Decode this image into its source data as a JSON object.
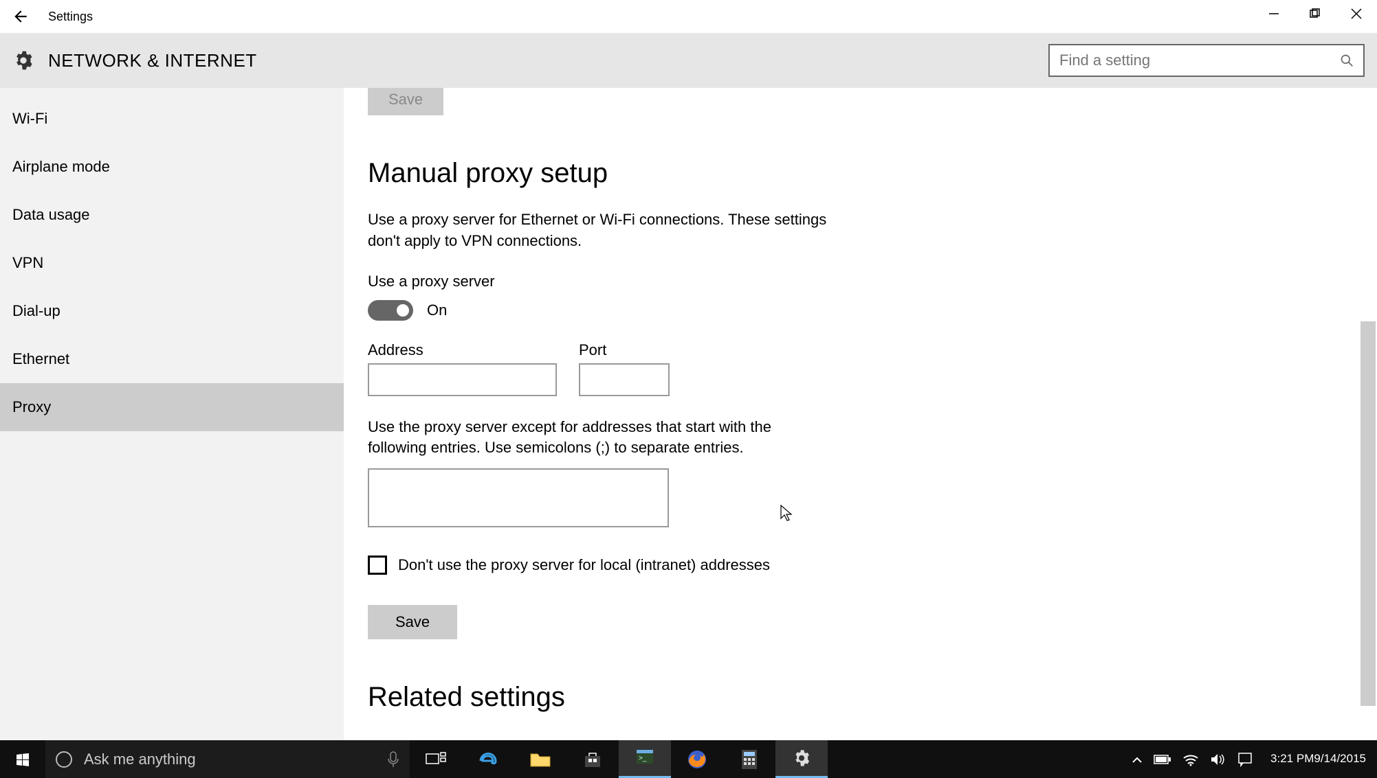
{
  "titlebar": {
    "title": "Settings"
  },
  "header": {
    "title": "NETWORK & INTERNET",
    "search_placeholder": "Find a setting"
  },
  "sidebar": {
    "items": [
      {
        "label": "Wi-Fi"
      },
      {
        "label": "Airplane mode"
      },
      {
        "label": "Data usage"
      },
      {
        "label": "VPN"
      },
      {
        "label": "Dial-up"
      },
      {
        "label": "Ethernet"
      },
      {
        "label": "Proxy"
      }
    ],
    "selected_index": 6
  },
  "main": {
    "save_top": "Save",
    "section_title": "Manual proxy setup",
    "description": "Use a proxy server for Ethernet or Wi-Fi connections. These settings don't apply to VPN connections.",
    "use_proxy_label": "Use a proxy server",
    "toggle_state": "On",
    "address_label": "Address",
    "address_value": "",
    "port_label": "Port",
    "port_value": "",
    "exceptions_desc": "Use the proxy server except for addresses that start with the following entries. Use semicolons (;) to separate entries.",
    "exceptions_value": "",
    "local_bypass_label": "Don't use the proxy server for local (intranet) addresses",
    "local_bypass_checked": false,
    "save_label": "Save",
    "related_title": "Related settings"
  },
  "taskbar": {
    "cortana_placeholder": "Ask me anything",
    "time": "3:21 PM",
    "date": "9/14/2015"
  }
}
